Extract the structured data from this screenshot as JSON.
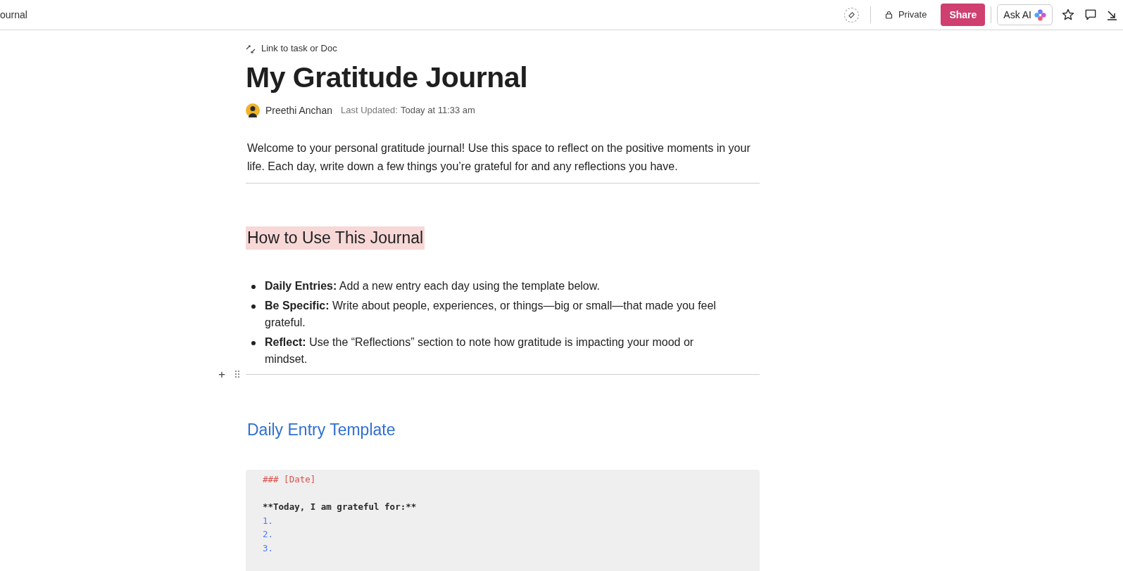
{
  "topbar": {
    "title": "ournal",
    "private_label": "Private",
    "share_label": "Share",
    "ask_ai_label": "Ask AI"
  },
  "doc": {
    "link_label": "Link to task or Doc",
    "title": "My Gratitude Journal",
    "author": "Preethi Anchan",
    "updated_label": "Last Updated:",
    "updated_value": "Today at 11:33 am",
    "intro": "Welcome to your personal gratitude journal! Use this space to reflect on the positive moments in your life. Each day, write down a few things you’re grateful for and any reflections you have.",
    "section_heading": "How to Use This Journal",
    "bullets": [
      "**Daily Entries:** Add a new entry each day using the template below.",
      "**Be Specific:** Write about people, experiences, or things—big or small—that made you feel grateful.",
      "**Reflect:** Use the “Reflections” section to note how gratitude is impacting your mood or mindset."
    ],
    "add_block_symbol": "+",
    "template_heading": "Daily Entry Template",
    "code_lines": [
      {
        "kind": "heading",
        "text": "### [Date]"
      },
      {
        "kind": "blank"
      },
      {
        "kind": "bold",
        "text": "**Today, I am grateful for:**"
      },
      {
        "kind": "list",
        "text": "1."
      },
      {
        "kind": "list",
        "text": "2."
      },
      {
        "kind": "list",
        "text": "3."
      },
      {
        "kind": "blank"
      }
    ]
  }
}
